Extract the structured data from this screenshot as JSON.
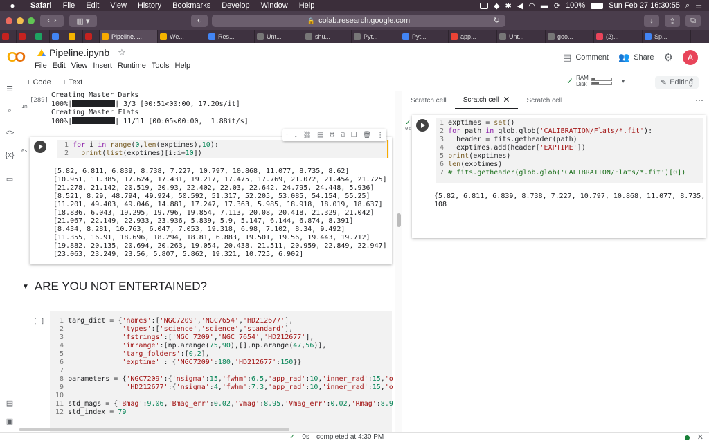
{
  "menubar": {
    "app": "Safari",
    "items": [
      "File",
      "Edit",
      "View",
      "History",
      "Bookmarks",
      "Develop",
      "Window",
      "Help"
    ],
    "battery": "100%",
    "datetime": "Sun Feb 27  16:30:55"
  },
  "browser": {
    "url": "colab.research.google.com",
    "tabs": [
      {
        "label": "",
        "color": "#c5221f"
      },
      {
        "label": "",
        "color": "#c5221f"
      },
      {
        "label": "",
        "color": "#1ea362"
      },
      {
        "label": "",
        "color": "#4285f4"
      },
      {
        "label": "",
        "color": "#f4b400"
      },
      {
        "label": "",
        "color": "#c5221f"
      },
      {
        "label": "Pipeline.i...",
        "color": "#f9ab00",
        "active": true
      },
      {
        "label": "We...",
        "color": "#f4b400"
      },
      {
        "label": "Res...",
        "color": "#4285f4"
      },
      {
        "label": "Unt...",
        "color": "#777777"
      },
      {
        "label": "shu...",
        "color": "#777777"
      },
      {
        "label": "Pyt...",
        "color": "#777777"
      },
      {
        "label": "Pyt...",
        "color": "#4285f4"
      },
      {
        "label": "app...",
        "color": "#ea4335"
      },
      {
        "label": "Unt...",
        "color": "#777777"
      },
      {
        "label": "goo...",
        "color": "#777777"
      },
      {
        "label": "(2)...",
        "color": "#e8445a"
      },
      {
        "label": "Sp...",
        "color": "#4285f4"
      }
    ]
  },
  "colab": {
    "logo": "CO",
    "title": "Pipeline.ipynb",
    "menu": [
      "File",
      "Edit",
      "View",
      "Insert",
      "Runtime",
      "Tools",
      "Help"
    ],
    "comment_label": "Comment",
    "share_label": "Share",
    "avatar_letter": "A",
    "toolbar": {
      "add_code": "+ Code",
      "add_text": "+ Text"
    },
    "resources": {
      "ram_label": "RAM",
      "disk_label": "Disk",
      "ram_fraction": 0.2,
      "disk_fraction": 0.35
    },
    "editing_label": "Editing"
  },
  "notebook": {
    "output_top": {
      "count": "[289]",
      "exec_time": "1m",
      "lines": [
        {
          "kind": "text",
          "text": "Creating Master Darks"
        },
        {
          "kind": "progress",
          "prefix": "100%|",
          "suffix": "| 3/3 [00:51<00:00, 17.20s/it]"
        },
        {
          "kind": "text",
          "text": "Creating Master Flats"
        },
        {
          "kind": "progress",
          "prefix": "100%|",
          "suffix": "| 11/11 [00:05<00:00,  1.88it/s]"
        }
      ]
    },
    "cell1": {
      "exec_time": "0s",
      "output": [
        "[5.82, 6.811, 6.839, 8.738, 7.227, 10.797, 10.868, 11.077, 8.735, 8.62]",
        "[10.951, 11.385, 17.624, 17.431, 19.217, 17.475, 17.769, 21.072, 21.454, 21.725]",
        "[21.278, 21.142, 20.519, 20.93, 22.402, 22.03, 22.642, 24.795, 24.448, 5.936]",
        "[8.521, 8.29, 48.794, 49.924, 50.592, 51.317, 52.205, 53.085, 54.154, 55.25]",
        "[11.201, 49.403, 49.046, 14.881, 17.247, 17.363, 5.985, 18.918, 18.019, 18.637]",
        "[18.836, 6.043, 19.295, 19.796, 19.854, 7.113, 20.08, 20.418, 21.329, 21.042]",
        "[21.067, 22.149, 22.933, 23.936, 5.839, 5.9, 5.147, 6.144, 6.874, 8.391]",
        "[8.434, 8.281, 10.763, 6.047, 7.053, 19.318, 6.98, 7.102, 8.34, 9.492]",
        "[11.355, 16.91, 18.696, 18.294, 18.81, 6.883, 19.501, 19.56, 19.443, 19.712]",
        "[19.882, 20.135, 20.694, 20.263, 19.054, 20.438, 21.511, 20.959, 22.849, 22.947]",
        "[23.063, 23.249, 23.56, 5.807, 5.862, 19.321, 10.725, 6.902]"
      ]
    },
    "heading": "ARE YOU NOT ENTERTAINED?",
    "cell2": {
      "count": "[ ]"
    }
  },
  "scratch": {
    "tabs": [
      "Scratch cell",
      "Scratch cell",
      "Scratch cell"
    ],
    "exec_time": "0s",
    "output": [
      "{5.82, 6.811, 6.839, 8.738, 7.227, 10.797, 10.868, 11.077, 8.735,",
      "108"
    ]
  },
  "status": {
    "time": "0s",
    "message": "completed at 4:30 PM"
  }
}
